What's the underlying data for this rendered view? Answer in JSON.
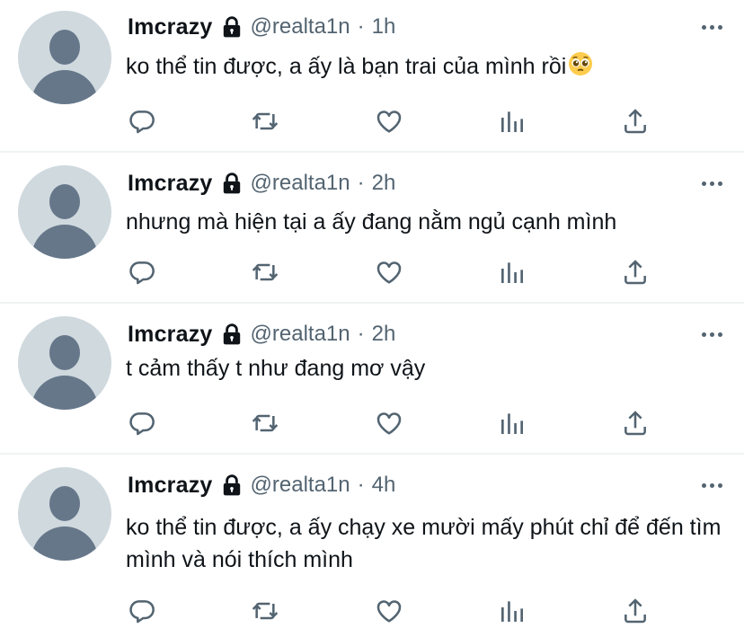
{
  "tweets": [
    {
      "name": "Imcrazy",
      "handle": "@realta1n",
      "separator": "·",
      "time": "1h",
      "text": "ko thể tin được, a ấy là bạn trai của mình rồi",
      "emoji": "pleading-face"
    },
    {
      "name": "Imcrazy",
      "handle": "@realta1n",
      "separator": "·",
      "time": "2h",
      "text": "nhưng mà hiện tại a ấy đang nằm ngủ cạnh mình"
    },
    {
      "name": "Imcrazy",
      "handle": "@realta1n",
      "separator": "·",
      "time": "2h",
      "text": "t cảm thấy t như đang mơ vậy"
    },
    {
      "name": "Imcrazy",
      "handle": "@realta1n",
      "separator": "·",
      "time": "4h",
      "text": "ko thể tin được, a ấy chạy xe mười mấy phút chỉ để đến tìm mình và nói thích mình"
    }
  ],
  "icons": {
    "lock": "lock-icon",
    "more": "more-dots-icon",
    "reply": "reply-icon",
    "retweet": "retweet-icon",
    "like": "heart-icon",
    "views": "analytics-icon",
    "share": "share-icon"
  },
  "colors": {
    "text": "#0f1419",
    "secondary": "#536471",
    "avatar_bg": "#cfd9de",
    "avatar_fg": "#66778a",
    "divider": "#eff3f4"
  }
}
